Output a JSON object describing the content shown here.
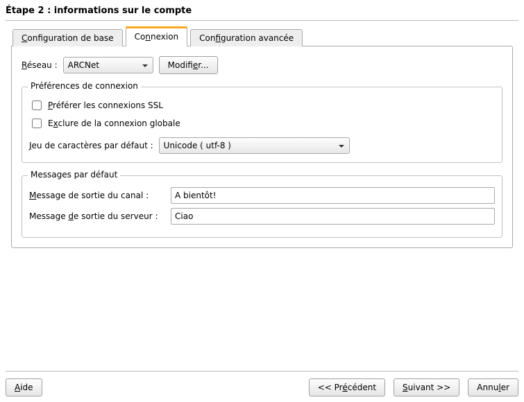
{
  "title": "Étape 2 : informations sur le compte",
  "tabs": {
    "basic_pre": "C",
    "basic_rest": "onfiguration de base",
    "conn_pre": "Co",
    "conn_u": "n",
    "conn_rest": "nexion",
    "adv_pre": "Con",
    "adv_u": "f",
    "adv_rest": "iguration avancée"
  },
  "network": {
    "label_u": "R",
    "label_rest": "éseau :",
    "value": "ARCNet",
    "modify_pre": "Modifi",
    "modify_u": "e",
    "modify_rest": "r..."
  },
  "conn_prefs": {
    "legend": "Préférences de connexion",
    "ssl_u": "P",
    "ssl_rest": "référer les connexions SSL",
    "excl_pre": "E",
    "excl_u": "x",
    "excl_rest": "clure de la connexion globale",
    "charset_u": "J",
    "charset_rest": "eu de caractères par défaut :",
    "charset_value": "Unicode ( utf-8 )"
  },
  "messages": {
    "legend": "Messages par défaut",
    "part_u": "M",
    "part_rest": "essage de sortie du canal :",
    "part_value": "A bientôt!",
    "quit_pre": "Message ",
    "quit_u": "d",
    "quit_rest": "e sortie du serveur :",
    "quit_value": "Ciao"
  },
  "footer": {
    "help_u": "A",
    "help_rest": "ide",
    "back_pre": "<< Pr",
    "back_u": "é",
    "back_rest": "cédent",
    "next_u": "S",
    "next_rest": "uivant >>",
    "cancel_pre": "Annu",
    "cancel_u": "l",
    "cancel_rest": "er"
  }
}
